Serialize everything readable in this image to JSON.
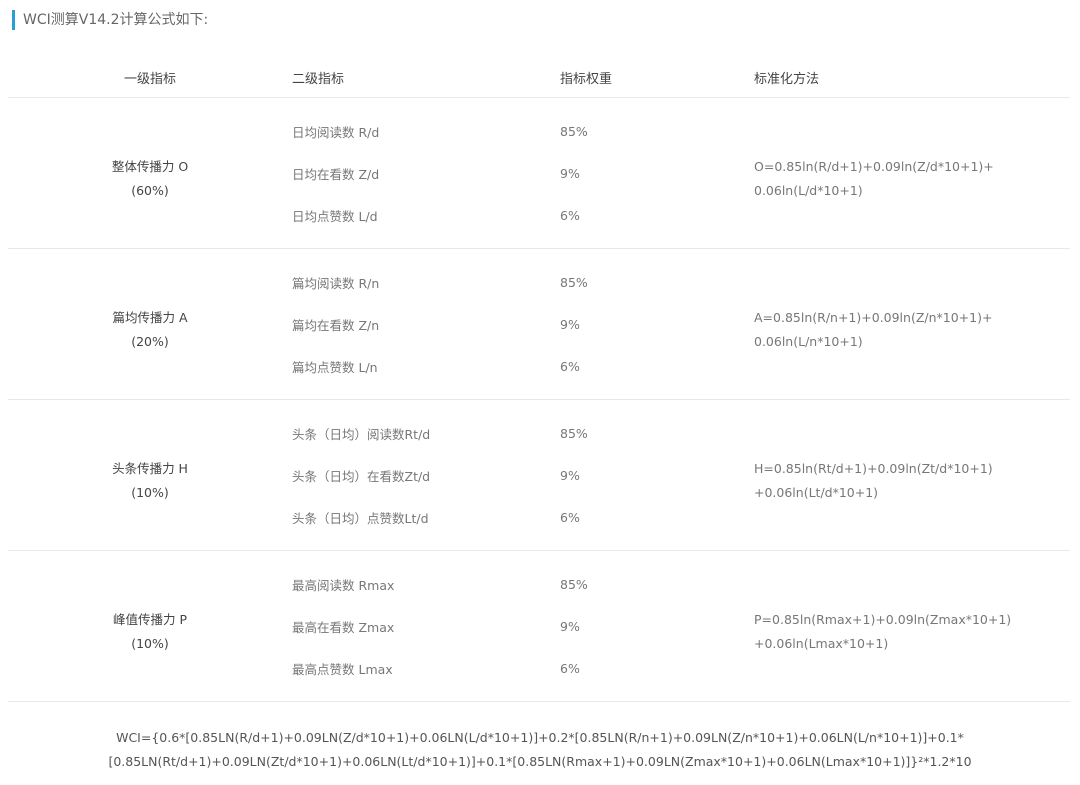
{
  "heading": "WCI测算V14.2计算公式如下:",
  "headers": {
    "primary": "一级指标",
    "secondary": "二级指标",
    "weight": "指标权重",
    "method": "标准化方法"
  },
  "groups": [
    {
      "name": "整体传播力 O",
      "percent": "(60%)",
      "items": [
        {
          "label": "日均阅读数 R/d",
          "weight": "85%"
        },
        {
          "label": "日均在看数 Z/d",
          "weight": "9%"
        },
        {
          "label": "日均点赞数 L/d",
          "weight": "6%"
        }
      ],
      "formula_line1": "O=0.85ln(R/d+1)+0.09ln(Z/d*10+1)+",
      "formula_line2": "0.06ln(L/d*10+1)"
    },
    {
      "name": "篇均传播力 A",
      "percent": "(20%)",
      "items": [
        {
          "label": "篇均阅读数 R/n",
          "weight": "85%"
        },
        {
          "label": "篇均在看数 Z/n",
          "weight": "9%"
        },
        {
          "label": "篇均点赞数 L/n",
          "weight": "6%"
        }
      ],
      "formula_line1": "A=0.85ln(R/n+1)+0.09ln(Z/n*10+1)+",
      "formula_line2": "0.06ln(L/n*10+1)"
    },
    {
      "name": "头条传播力 H",
      "percent": "(10%)",
      "items": [
        {
          "label": "头条（日均）阅读数Rt/d",
          "weight": "85%"
        },
        {
          "label": "头条（日均）在看数Zt/d",
          "weight": "9%"
        },
        {
          "label": "头条（日均）点赞数Lt/d",
          "weight": "6%"
        }
      ],
      "formula_line1": "H=0.85ln(Rt/d+1)+0.09ln(Zt/d*10+1)",
      "formula_line2": "+0.06ln(Lt/d*10+1)"
    },
    {
      "name": "峰值传播力 P",
      "percent": "(10%)",
      "items": [
        {
          "label": "最高阅读数 Rmax",
          "weight": "85%"
        },
        {
          "label": "最高在看数 Zmax",
          "weight": "9%"
        },
        {
          "label": "最高点赞数 Lmax",
          "weight": "6%"
        }
      ],
      "formula_line1": "P=0.85ln(Rmax+1)+0.09ln(Zmax*10+1)",
      "formula_line2": "+0.06ln(Lmax*10+1)"
    }
  ],
  "total_formula": {
    "line1": "WCI={0.6*[0.85LN(R/d+1)+0.09LN(Z/d*10+1)+0.06LN(L/d*10+1)]+0.2*[0.85LN(R/n+1)+0.09LN(Z/n*10+1)+0.06LN(L/n*10+1)]+0.1*",
    "line2": "[0.85LN(Rt/d+1)+0.09LN(Zt/d*10+1)+0.06LN(Lt/d*10+1)]+0.1*[0.85LN(Rmax+1)+0.09LN(Zmax*10+1)+0.06LN(Lmax*10+1)]}²*1.2*10"
  }
}
